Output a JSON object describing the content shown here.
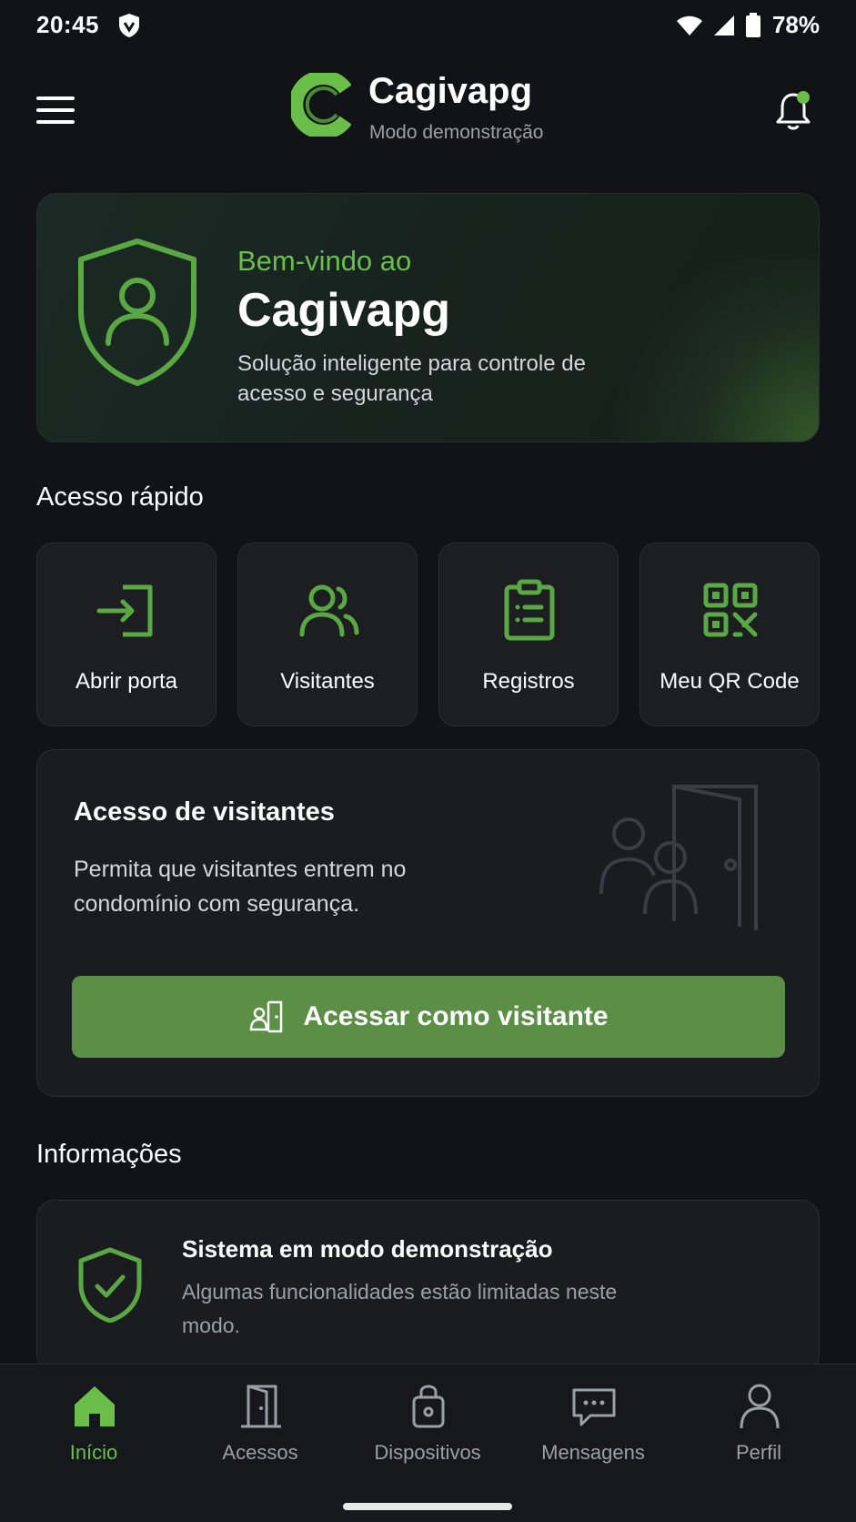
{
  "status_bar": {
    "time": "20:45",
    "battery_pct": "78%",
    "icons": [
      "shield-icon",
      "wifi-icon",
      "signal-icon",
      "battery-icon"
    ]
  },
  "header": {
    "menu_icon": "hamburger-menu-icon",
    "app_name": "Cagivapg",
    "app_subtitle": "Modo demonstração",
    "notification_icon": "bell-icon",
    "notification_dot_color": "#6abf4b"
  },
  "hero": {
    "kicker": "Bem-vindo ao",
    "title": "Cagivapg",
    "description": "Solução inteligente para controle de acesso e segurança",
    "icon": "shield-user-icon"
  },
  "quick_access": {
    "title": "Acesso rápido",
    "items": [
      {
        "label": "Abrir porta",
        "icon": "door-enter-icon"
      },
      {
        "label": "Visitantes",
        "icon": "users-icon"
      },
      {
        "label": "Registros",
        "icon": "clipboard-list-icon"
      },
      {
        "label": "Meu QR Code",
        "icon": "qr-code-icon"
      }
    ]
  },
  "visitor_card": {
    "title": "Acesso de visitantes",
    "description": "Permita que visitantes entrem no condomínio com segurança.",
    "button_label": "Acessar como visitante",
    "button_icon": "visitor-door-icon"
  },
  "info": {
    "title": "Informações",
    "card_title": "Sistema em modo demonstração",
    "card_desc": "Algumas funcionalidades estão limitadas neste modo.",
    "icon": "shield-check-icon"
  },
  "bottom_nav": {
    "items": [
      {
        "label": "Início",
        "icon": "home-icon",
        "active": true
      },
      {
        "label": "Acessos",
        "icon": "door-icon",
        "active": false
      },
      {
        "label": "Dispositivos",
        "icon": "lock-device-icon",
        "active": false
      },
      {
        "label": "Mensagens",
        "icon": "chat-icon",
        "active": false
      },
      {
        "label": "Perfil",
        "icon": "user-icon",
        "active": false
      }
    ]
  },
  "colors": {
    "accent": "#6abf4b",
    "button": "#5a8f45",
    "background": "#121316",
    "card": "#1a1c20"
  }
}
